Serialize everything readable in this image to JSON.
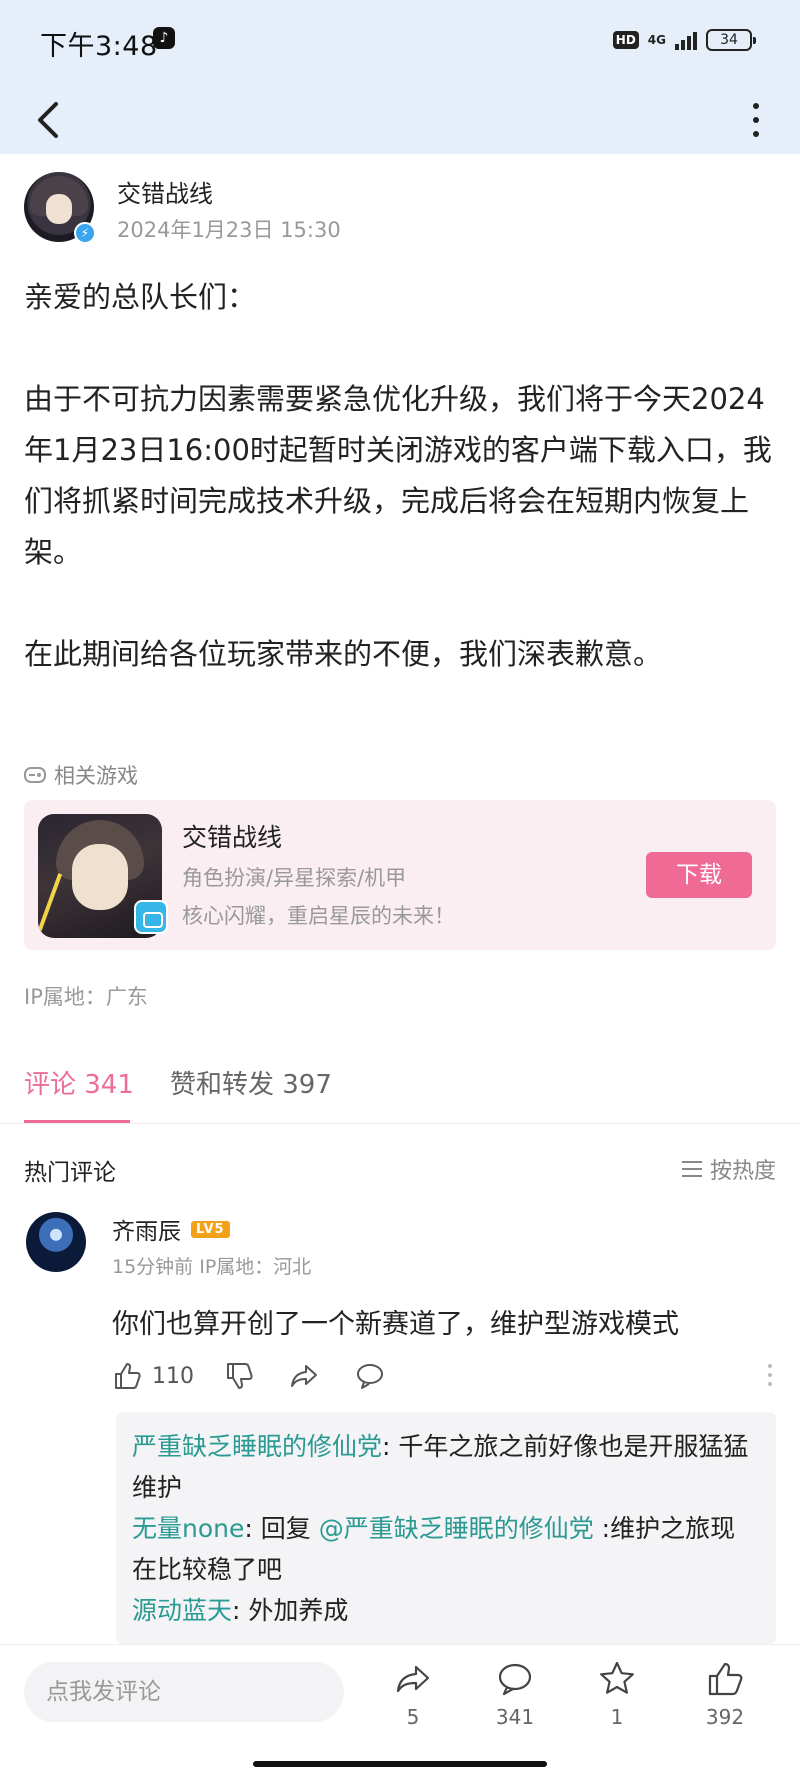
{
  "status_bar": {
    "time": "下午3:48",
    "hd_label": "HD",
    "network_label": "4G",
    "battery": "34"
  },
  "post": {
    "author_name": "交错战线",
    "timestamp": "2024年1月23日 15:30",
    "paragraphs": [
      "亲爱的总队长们：",
      "由于不可抗力因素需要紧急优化升级，我们将于今天2024年1月23日16:00时起暂时关闭游戏的客户端下载入口，我们将抓紧时间完成技术升级，完成后将会在短期内恢复上架。",
      "在此期间给各位玩家带来的不便，我们深表歉意。"
    ],
    "related_games_label": "相关游戏",
    "ip_location": "IP属地：广东"
  },
  "game_card": {
    "name": "交错战线",
    "tags": "角色扮演/异星探索/机甲",
    "slogan": "核心闪耀，重启星辰的未来！",
    "download_label": "下载"
  },
  "tabs": {
    "comments_label": "评论 341",
    "likes_label": "赞和转发 397"
  },
  "comments_section": {
    "hot_title": "热门评论",
    "sort_label": "按热度"
  },
  "comment": {
    "username": "齐雨辰",
    "level_badge": "LV5",
    "meta": "15分钟前  IP属地：河北",
    "text": "你们也算开创了一个新赛道了，维护型游戏模式",
    "like_count": "110"
  },
  "replies": [
    {
      "user": "严重缺乏睡眠的修仙党",
      "sep": ": ",
      "mention": "",
      "text": "千年之旅之前好像也是开服猛猛维护"
    },
    {
      "user": "无量none",
      "sep": ": ",
      "prefix": "回复 ",
      "mention": "@严重缺乏睡眠的修仙党",
      "text": " :维护之旅现在比较稳了吧"
    },
    {
      "user": "源动蓝天",
      "sep": ": ",
      "mention": "",
      "text": "外加养成"
    }
  ],
  "bottom_bar": {
    "input_placeholder": "点我发评论",
    "share_count": "5",
    "comment_count": "341",
    "favorite_count": "1",
    "like_count": "392"
  }
}
